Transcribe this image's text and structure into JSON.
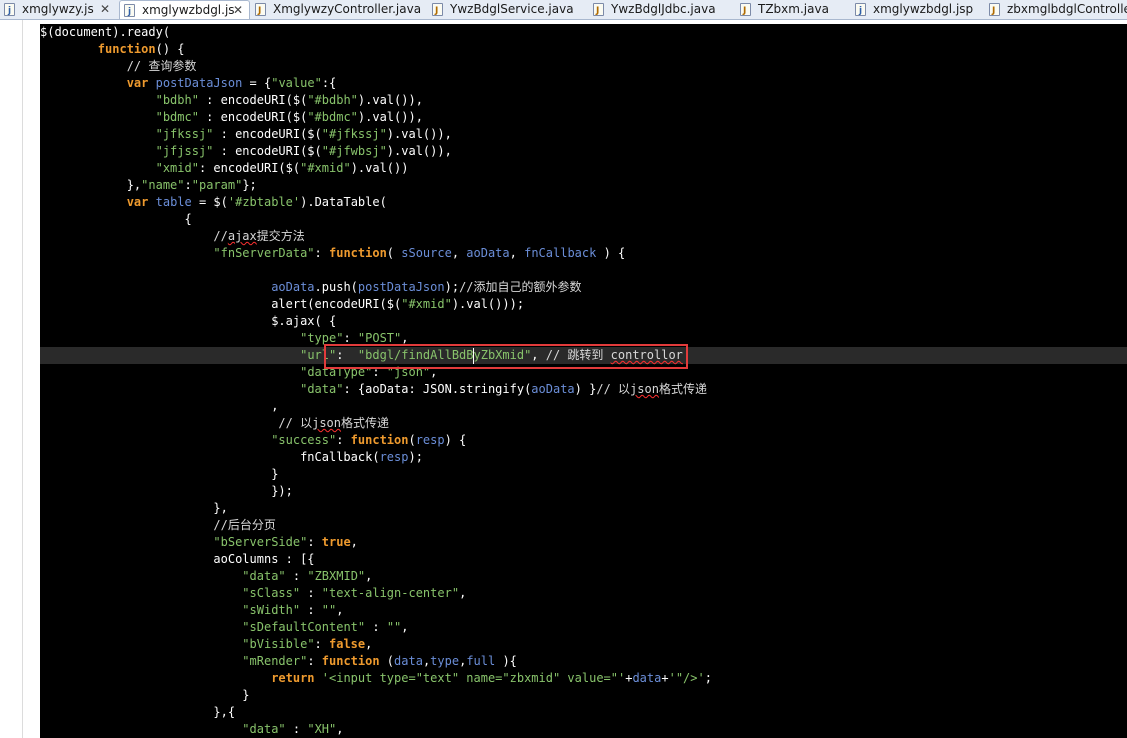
{
  "tabs": [
    {
      "label": "xmglywzy.js",
      "icon": "js-file-icon",
      "active": false,
      "closable": true
    },
    {
      "label": "xmglywzbdgl.js",
      "icon": "js-file-icon",
      "active": true,
      "closable": true
    },
    {
      "label": "XmglywzyController.java",
      "icon": "java-file-icon",
      "active": false,
      "closable": false
    },
    {
      "label": "YwzBdglService.java",
      "icon": "java-file-icon",
      "active": false,
      "closable": false
    },
    {
      "label": "YwzBdglJdbc.java",
      "icon": "java-file-icon",
      "active": false,
      "closable": false
    },
    {
      "label": "TZbxm.java",
      "icon": "java-file-icon",
      "active": false,
      "closable": false
    },
    {
      "label": "xmglywzbdgl.jsp",
      "icon": "jsp-file-icon",
      "active": false,
      "closable": false
    },
    {
      "label": "zbxmglbdglController.java",
      "icon": "java-file-icon",
      "active": false,
      "closable": false
    }
  ],
  "close_glyph": "✕",
  "code_lines": [
    [
      [
        "",
        "$(document).ready("
      ]
    ],
    [
      [
        "",
        "        "
      ],
      [
        "kw",
        "function"
      ],
      [
        "",
        "() {"
      ]
    ],
    [
      [
        "",
        "            "
      ],
      [
        "cm",
        "// 查询参数"
      ]
    ],
    [
      [
        "",
        "            "
      ],
      [
        "kw",
        "var"
      ],
      [
        "",
        " "
      ],
      [
        "vr",
        "postDataJson"
      ],
      [
        "",
        " = {"
      ],
      [
        "st",
        "\"value\""
      ],
      [
        "",
        ":{"
      ]
    ],
    [
      [
        "",
        "                "
      ],
      [
        "st",
        "\"bdbh\""
      ],
      [
        "",
        " : encodeURI($("
      ],
      [
        "st",
        "\"#bdbh\""
      ],
      [
        "",
        ").val()),"
      ]
    ],
    [
      [
        "",
        "                "
      ],
      [
        "st",
        "\"bdmc\""
      ],
      [
        "",
        " : encodeURI($("
      ],
      [
        "st",
        "\"#bdmc\""
      ],
      [
        "",
        ").val()),"
      ]
    ],
    [
      [
        "",
        "                "
      ],
      [
        "st",
        "\"jfkssj\""
      ],
      [
        "",
        " : encodeURI($("
      ],
      [
        "st",
        "\"#jfkssj\""
      ],
      [
        "",
        ").val()),"
      ]
    ],
    [
      [
        "",
        "                "
      ],
      [
        "st",
        "\"jfjssj\""
      ],
      [
        "",
        " : encodeURI($("
      ],
      [
        "st",
        "\"#jfwbsj\""
      ],
      [
        "",
        ").val()),"
      ]
    ],
    [
      [
        "",
        "                "
      ],
      [
        "st",
        "\"xmid\""
      ],
      [
        "",
        ": encodeURI($("
      ],
      [
        "st",
        "\"#xmid\""
      ],
      [
        "",
        ").val())"
      ]
    ],
    [
      [
        "",
        "            },"
      ],
      [
        "st",
        "\"name\""
      ],
      [
        "",
        ":"
      ],
      [
        "st",
        "\"param\""
      ],
      [
        "",
        "};"
      ]
    ],
    [
      [
        "",
        "            "
      ],
      [
        "kw",
        "var"
      ],
      [
        "",
        " "
      ],
      [
        "vr",
        "table"
      ],
      [
        "",
        " = $("
      ],
      [
        "st",
        "'#zbtable'"
      ],
      [
        "",
        ").DataTable("
      ]
    ],
    [
      [
        "",
        "                    {"
      ]
    ],
    [
      [
        "",
        "                        "
      ],
      [
        "cm",
        "//"
      ],
      [
        "wv cm",
        "ajax"
      ],
      [
        "cm",
        "提交方法"
      ]
    ],
    [
      [
        "",
        "                        "
      ],
      [
        "st",
        "\"fnServerData\""
      ],
      [
        "",
        ": "
      ],
      [
        "kw",
        "function"
      ],
      [
        "",
        "( "
      ],
      [
        "vr",
        "sSource"
      ],
      [
        "",
        ", "
      ],
      [
        "vr",
        "aoData"
      ],
      [
        "",
        ", "
      ],
      [
        "vr",
        "fnCallback"
      ],
      [
        "",
        " ) {"
      ]
    ],
    [
      [
        "",
        ""
      ]
    ],
    [
      [
        "",
        "                                "
      ],
      [
        "vr",
        "aoData"
      ],
      [
        "",
        ".push("
      ],
      [
        "vr",
        "postDataJson"
      ],
      [
        "",
        ");"
      ],
      [
        "cm",
        "//添加自己的额外参数"
      ]
    ],
    [
      [
        "",
        "                                alert(encodeURI($("
      ],
      [
        "st",
        "\"#xmid\""
      ],
      [
        "",
        ").val()));"
      ]
    ],
    [
      [
        "",
        "                                $.ajax( {"
      ]
    ],
    [
      [
        "",
        "                                    "
      ],
      [
        "st",
        "\"type\""
      ],
      [
        "",
        ": "
      ],
      [
        "st",
        "\"POST\""
      ],
      [
        "",
        ","
      ]
    ],
    [
      [
        "",
        "                                    "
      ],
      [
        "st",
        "\"url\""
      ],
      [
        "",
        ":  "
      ],
      [
        "st",
        "\"bdgl/findAllBdByZbXmid\""
      ],
      [
        "",
        ", "
      ],
      [
        "cm",
        "// 跳转到 "
      ],
      [
        "wv cm",
        "controllor"
      ]
    ],
    [
      [
        "",
        "                                    "
      ],
      [
        "st",
        "\"dataType\""
      ],
      [
        "",
        ": "
      ],
      [
        "st",
        "\"json\""
      ],
      [
        "",
        ","
      ]
    ],
    [
      [
        "",
        "                                    "
      ],
      [
        "st",
        "\"data\""
      ],
      [
        "",
        ": {aoData: JSON.stringify("
      ],
      [
        "vr",
        "aoData"
      ],
      [
        "",
        ") }"
      ],
      [
        "cm",
        "// 以"
      ],
      [
        "wv cm",
        "json"
      ],
      [
        "cm",
        "格式传递"
      ]
    ],
    [
      [
        "",
        "                                ,"
      ]
    ],
    [
      [
        "",
        "                                 "
      ],
      [
        "cm",
        "// 以"
      ],
      [
        "wv cm",
        "json"
      ],
      [
        "cm",
        "格式传递"
      ]
    ],
    [
      [
        "",
        "                                "
      ],
      [
        "st",
        "\"success\""
      ],
      [
        "",
        ": "
      ],
      [
        "kw",
        "function"
      ],
      [
        "",
        "("
      ],
      [
        "vr",
        "resp"
      ],
      [
        "",
        ") {"
      ]
    ],
    [
      [
        "",
        "                                    fnCallback("
      ],
      [
        "vr",
        "resp"
      ],
      [
        "",
        ");"
      ]
    ],
    [
      [
        "",
        "                                }"
      ]
    ],
    [
      [
        "",
        "                                });"
      ]
    ],
    [
      [
        "",
        "                        },"
      ]
    ],
    [
      [
        "",
        "                        "
      ],
      [
        "cm",
        "//后台分页"
      ]
    ],
    [
      [
        "",
        "                        "
      ],
      [
        "st",
        "\"bServerSide\""
      ],
      [
        "",
        ": "
      ],
      [
        "kw",
        "true"
      ],
      [
        "",
        ","
      ]
    ],
    [
      [
        "",
        "                        aoColumns : [{"
      ]
    ],
    [
      [
        "",
        "                            "
      ],
      [
        "st",
        "\"data\""
      ],
      [
        "",
        " : "
      ],
      [
        "st",
        "\"ZBXMID\""
      ],
      [
        "",
        ","
      ]
    ],
    [
      [
        "",
        "                            "
      ],
      [
        "st",
        "\"sClass\""
      ],
      [
        "",
        " : "
      ],
      [
        "st",
        "\"text-align-center\""
      ],
      [
        "",
        ","
      ]
    ],
    [
      [
        "",
        "                            "
      ],
      [
        "st",
        "\"sWidth\""
      ],
      [
        "",
        " : "
      ],
      [
        "st",
        "\"\""
      ],
      [
        "",
        ","
      ]
    ],
    [
      [
        "",
        "                            "
      ],
      [
        "st",
        "\"sDefaultContent\""
      ],
      [
        "",
        " : "
      ],
      [
        "st",
        "\"\""
      ],
      [
        "",
        ","
      ]
    ],
    [
      [
        "",
        "                            "
      ],
      [
        "st",
        "\"bVisible\""
      ],
      [
        "",
        ": "
      ],
      [
        "kw",
        "false"
      ],
      [
        "",
        ","
      ]
    ],
    [
      [
        "",
        "                            "
      ],
      [
        "st",
        "\"mRender\""
      ],
      [
        "",
        ": "
      ],
      [
        "kw",
        "function"
      ],
      [
        "",
        " ("
      ],
      [
        "vr",
        "data"
      ],
      [
        "",
        ","
      ],
      [
        "vr",
        "type"
      ],
      [
        "",
        ","
      ],
      [
        "vr",
        "full"
      ],
      [
        "",
        " ){"
      ]
    ],
    [
      [
        "",
        "                                "
      ],
      [
        "kw",
        "return"
      ],
      [
        "",
        " "
      ],
      [
        "st",
        "'<input type=\"text\" name=\"zbxmid\" value=\"'"
      ],
      [
        "",
        "+"
      ],
      [
        "vr",
        "data"
      ],
      [
        "",
        "+"
      ],
      [
        "st",
        "'\"/>'"
      ],
      [
        "",
        ";"
      ]
    ],
    [
      [
        "",
        "                            }"
      ]
    ],
    [
      [
        "",
        "                        },{"
      ]
    ],
    [
      [
        "",
        "                            "
      ],
      [
        "st",
        "\"data\""
      ],
      [
        "",
        " : "
      ],
      [
        "st",
        "\"XH\""
      ],
      [
        "",
        ","
      ]
    ]
  ],
  "current_line": 19
}
